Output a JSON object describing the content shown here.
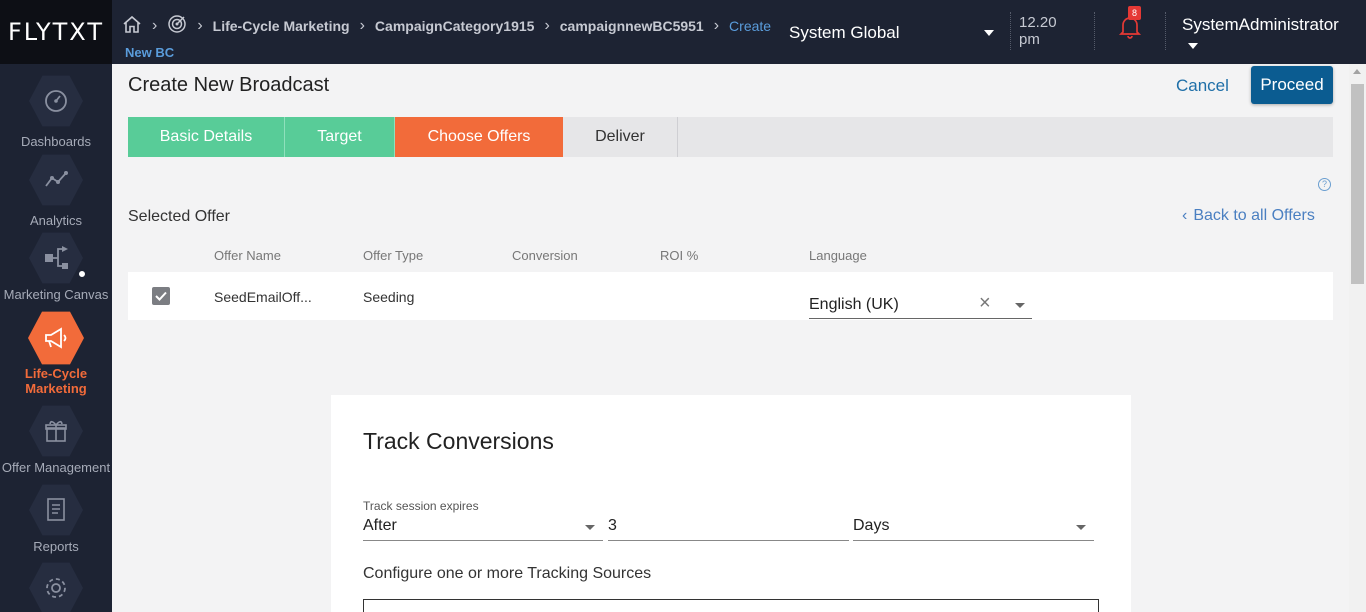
{
  "brand": {
    "logo": "FLYTXT"
  },
  "breadcrumb": {
    "items": [
      "Life-Cycle Marketing",
      "CampaignCategory1915",
      "campaignnewBC5951"
    ],
    "current": "Create",
    "current_line2": "New BC"
  },
  "header": {
    "scope": "System Global",
    "time": "12.20",
    "time_suffix": "pm",
    "notification_count": "8",
    "user": "SystemAdministrator"
  },
  "sidebar": {
    "items": [
      {
        "label": "Dashboards",
        "icon": "dashboard-icon"
      },
      {
        "label": "Analytics",
        "icon": "analytics-icon"
      },
      {
        "label": "Marketing Canvas",
        "icon": "canvas-icon"
      },
      {
        "label": "Life-Cycle Marketing",
        "icon": "megaphone-icon",
        "active": true
      },
      {
        "label": "Offer Management",
        "icon": "gift-icon"
      },
      {
        "label": "Reports",
        "icon": "report-icon"
      },
      {
        "label": "",
        "icon": "settings-icon"
      }
    ]
  },
  "page": {
    "title": "Create New Broadcast",
    "cancel": "Cancel",
    "proceed": "Proceed"
  },
  "steps": [
    {
      "label": "Basic Details",
      "state": "done"
    },
    {
      "label": "Target",
      "state": "done"
    },
    {
      "label": "Choose Offers",
      "state": "current"
    },
    {
      "label": "Deliver",
      "state": "todo"
    }
  ],
  "offers": {
    "section_label": "Selected Offer",
    "back_link": "Back to all Offers",
    "columns": [
      "Offer Name",
      "Offer Type",
      "Conversion",
      "ROI %",
      "Language"
    ],
    "rows": [
      {
        "checked": true,
        "name": "SeedEmailOff...",
        "type": "Seeding",
        "conversion": "",
        "roi": "",
        "language": "English (UK)"
      }
    ]
  },
  "track": {
    "title": "Track Conversions",
    "expires_label": "Track session expires",
    "expires_mode": "After",
    "expires_value": "3",
    "expires_unit": "Days",
    "sources_label": "Configure one or more Tracking Sources"
  },
  "colors": {
    "topbar": "#1d2333",
    "accent": "#f26b3a",
    "done": "#58cc98",
    "primary": "#0b5c91"
  }
}
